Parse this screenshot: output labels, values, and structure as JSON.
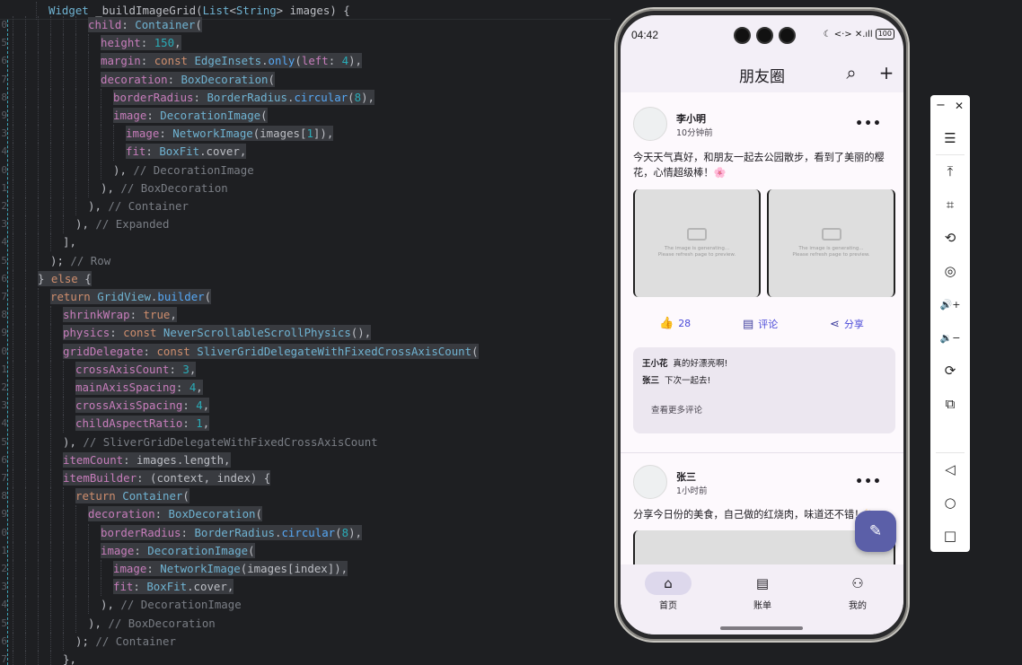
{
  "editor": {
    "gutter_nums": [
      "0",
      "5",
      "6",
      "7",
      "8",
      "9",
      "3",
      "4",
      "0",
      "1",
      "2",
      "3",
      "4",
      "5",
      "6",
      "7",
      "8",
      "9",
      "0",
      "1",
      "2",
      "3",
      "4",
      "5",
      "6",
      "7",
      "8",
      "9",
      "0",
      "1",
      "2",
      "3",
      "4",
      "5",
      "6",
      "7"
    ],
    "code_lines": [
      {
        "t": "Widget _buildImageGrid(List<String> images) {"
      },
      {
        "t": "child: Container("
      },
      {
        "t": "height: 150,"
      },
      {
        "t": "margin: const EdgeInsets.only(left: 4),"
      },
      {
        "t": "decoration: BoxDecoration("
      },
      {
        "t": "borderRadius: BorderRadius.circular(8),"
      },
      {
        "t": "image: DecorationImage("
      },
      {
        "t": "image: NetworkImage(images[1]),"
      },
      {
        "t": "fit: BoxFit.cover,"
      },
      {
        "t": "), // DecorationImage"
      },
      {
        "t": "), // BoxDecoration"
      },
      {
        "t": "), // Container"
      },
      {
        "t": "), // Expanded"
      },
      {
        "t": "],"
      },
      {
        "t": "); // Row"
      },
      {
        "t": "} else {"
      },
      {
        "t": "return GridView.builder("
      },
      {
        "t": "shrinkWrap: true,"
      },
      {
        "t": "physics: const NeverScrollableScrollPhysics(),"
      },
      {
        "t": "gridDelegate: const SliverGridDelegateWithFixedCrossAxisCount("
      },
      {
        "t": "crossAxisCount: 3,"
      },
      {
        "t": "mainAxisSpacing: 4,"
      },
      {
        "t": "crossAxisSpacing: 4,"
      },
      {
        "t": "childAspectRatio: 1,"
      },
      {
        "t": "), // SliverGridDelegateWithFixedCrossAxisCount"
      },
      {
        "t": "itemCount: images.length,"
      },
      {
        "t": "itemBuilder: (context, index) {"
      },
      {
        "t": "return Container("
      },
      {
        "t": "decoration: BoxDecoration("
      },
      {
        "t": "borderRadius: BorderRadius.circular(8),"
      },
      {
        "t": "image: DecorationImage("
      },
      {
        "t": "image: NetworkImage(images[index]),"
      },
      {
        "t": "fit: BoxFit.cover,"
      },
      {
        "t": "), // DecorationImage"
      },
      {
        "t": "), // BoxDecoration"
      },
      {
        "t": "); // Container"
      },
      {
        "t": "},"
      }
    ]
  },
  "phone": {
    "status": {
      "time": "04:42",
      "icons": "☾ <·> ✕.ıll",
      "battery": "100"
    },
    "appbar": {
      "title": "朋友圈",
      "search": "⌕",
      "add": "+"
    },
    "posts": [
      {
        "name": "李小明",
        "time": "10分钟前",
        "more": "•••",
        "text": "今天天气真好，和朋友一起去公园散步，看到了美丽的樱花，心情超级棒！🌸",
        "placeholder_line1": "The image is generating...",
        "placeholder_line2": "Please refresh page to preview.",
        "likes": "28",
        "comment_label": "评论",
        "share_label": "分享",
        "comments": [
          {
            "user": "王小花",
            "text": "真的好漂亮啊!"
          },
          {
            "user": "张三",
            "text": "下次一起去!"
          }
        ],
        "view_more": "查看更多评论"
      },
      {
        "name": "张三",
        "time": "1小时前",
        "more": "•••",
        "text": "分享今日份的美食，自己做的红烧肉，味道还不错！🍖"
      }
    ],
    "nav": [
      {
        "label": "首页",
        "icon": "⌂"
      },
      {
        "label": "账单",
        "icon": "▤"
      },
      {
        "label": "我的",
        "icon": "⚇"
      }
    ],
    "fab_icon": "✎"
  },
  "toolbar": {
    "minimize": "−",
    "close": "✕",
    "items": [
      "☰",
      "⤒",
      "⌗",
      "⟲",
      "◎",
      "🔊+",
      "🔉−",
      "⟳",
      "⧉",
      "◁",
      "○",
      "□"
    ]
  },
  "colors": {
    "accent": "#4a4ad8",
    "fab": "#5b5fa8",
    "nav_active": "#ddd8ec"
  }
}
